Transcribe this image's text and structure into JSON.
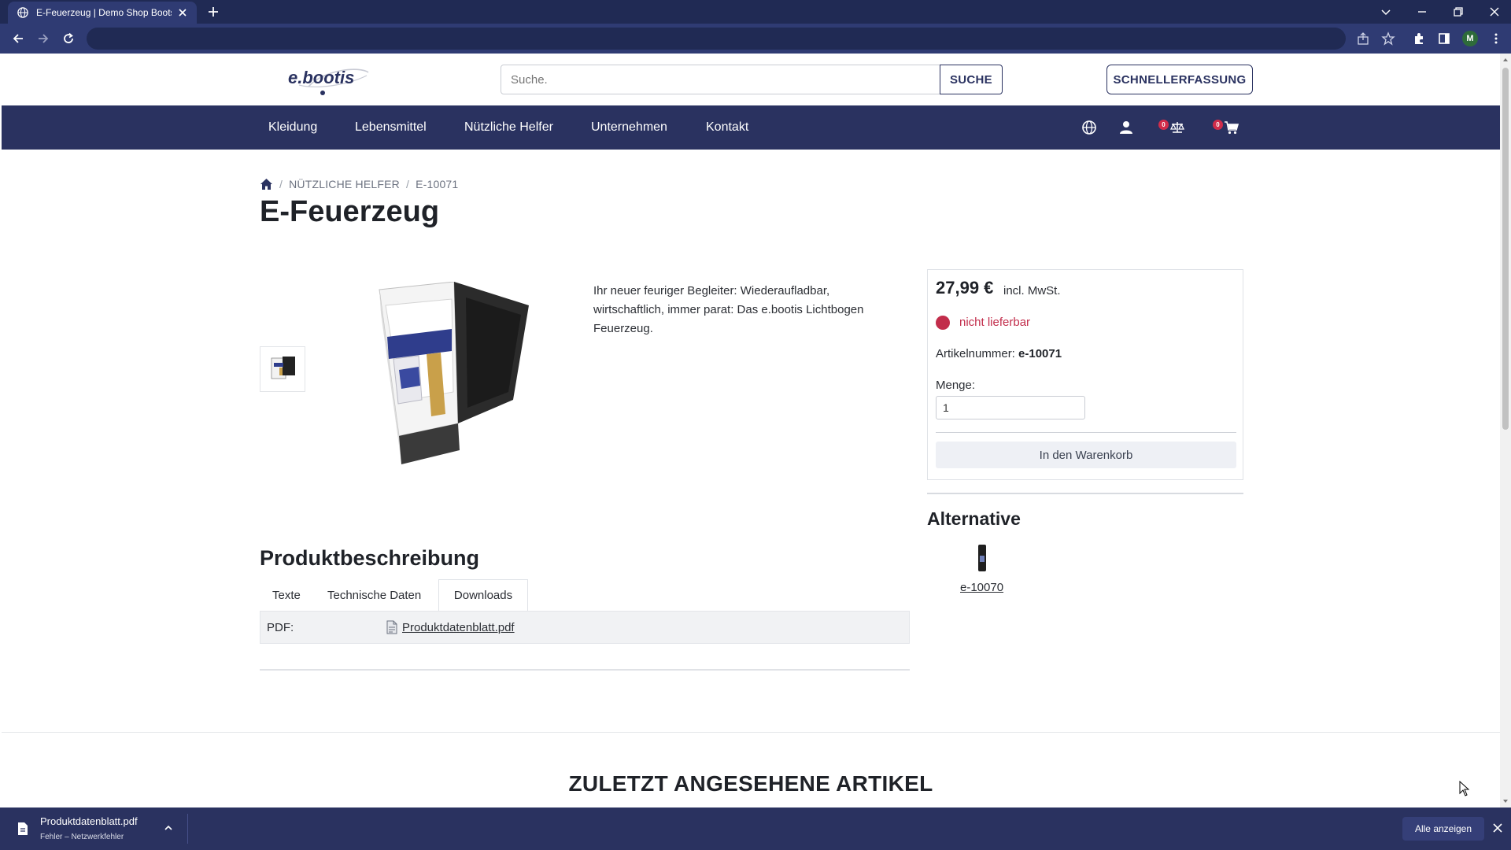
{
  "browser": {
    "tab_title": "E-Feuerzeug | Demo Shop Boots",
    "profile_initial": "M"
  },
  "header": {
    "logo_text": "e.bootis",
    "search_placeholder": "Suche.",
    "search_button": "SUCHE",
    "quick_entry_button": "SCHNELLERFASSUNG"
  },
  "nav": {
    "items": [
      "Kleidung",
      "Lebensmittel",
      "Nützliche Helfer",
      "Unternehmen",
      "Kontakt"
    ],
    "compare_count": "0",
    "cart_count": "0"
  },
  "breadcrumb": {
    "category": "NÜTZLICHE HELFER",
    "current": "E-10071"
  },
  "product": {
    "title": "E-Feuerzeug",
    "description": "Ihr neuer feuriger Begleiter: Wiederaufladbar, wirtschaftlich, immer parat: Das e.bootis Lichtbogen Feuerzeug.",
    "price": "27,99 €",
    "price_note": "incl. MwSt.",
    "availability": "nicht lieferbar",
    "article_label": "Artikelnummer:",
    "article_number": "e-10071",
    "quantity_label": "Menge:",
    "quantity_value": "1",
    "add_to_cart": "In den Warenkorb"
  },
  "alternative": {
    "title": "Alternative",
    "link": "e-10070"
  },
  "product_description": {
    "title": "Produktbeschreibung",
    "tabs": [
      "Texte",
      "Technische Daten",
      "Downloads"
    ],
    "download_label": "PDF:",
    "download_file": "Produktdatenblatt.pdf"
  },
  "recently_viewed": {
    "title": "ZULETZT ANGESEHENE ARTIKEL"
  },
  "download_shelf": {
    "file_name": "Produktdatenblatt.pdf",
    "status": "Fehler – Netzwerkfehler",
    "show_all": "Alle anzeigen"
  },
  "colors": {
    "brand_navy": "#2a3260",
    "unavailable_red": "#c22d4b",
    "badge_red": "#d12c4a"
  }
}
